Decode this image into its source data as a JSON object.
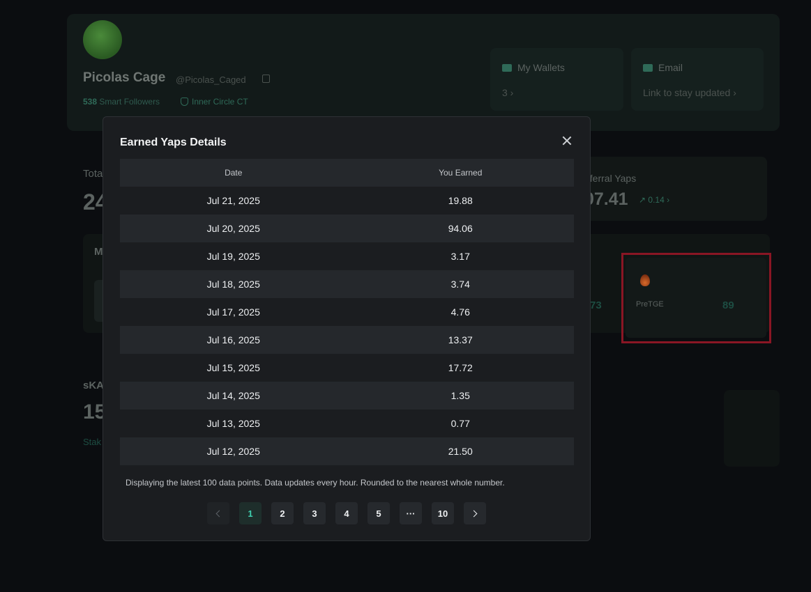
{
  "profile": {
    "name": "Picolas Cage",
    "handle": "@Picolas_Caged",
    "smart_followers_count": "538",
    "smart_followers_label": "Smart Followers",
    "inner_circle_label": "Inner Circle CT"
  },
  "cards": {
    "wallets_title": "My Wallets",
    "wallets_count": "3 ›",
    "email_title": "Email",
    "email_sub": "Link to stay updated ›"
  },
  "stats": {
    "total_label": "Tota",
    "total_value": "24",
    "referral_label": "eferral Yaps",
    "referral_value": "07.41",
    "referral_delta": "↗ 0.14 ›",
    "mid_label": "M",
    "mid_value": "73",
    "pretge_label": "PreTGE",
    "pretge_value": "89",
    "skaito_label": "sKA",
    "skaito_value": "15",
    "stake_link": "Stak"
  },
  "modal": {
    "title": "Earned Yaps Details",
    "columns": [
      "Date",
      "You Earned"
    ],
    "rows": [
      {
        "date": "Jul 21, 2025",
        "earned": "19.88"
      },
      {
        "date": "Jul 20, 2025",
        "earned": "94.06"
      },
      {
        "date": "Jul 19, 2025",
        "earned": "3.17"
      },
      {
        "date": "Jul 18, 2025",
        "earned": "3.74"
      },
      {
        "date": "Jul 17, 2025",
        "earned": "4.76"
      },
      {
        "date": "Jul 16, 2025",
        "earned": "13.37"
      },
      {
        "date": "Jul 15, 2025",
        "earned": "17.72"
      },
      {
        "date": "Jul 14, 2025",
        "earned": "1.35"
      },
      {
        "date": "Jul 13, 2025",
        "earned": "0.77"
      },
      {
        "date": "Jul 12, 2025",
        "earned": "21.50"
      }
    ],
    "footnote": "Displaying the latest 100 data points. Data updates every hour. Rounded to the nearest whole number.",
    "pagination": {
      "pages": [
        "1",
        "2",
        "3",
        "4",
        "5",
        "···",
        "10"
      ],
      "current": "1"
    }
  },
  "colors": {
    "accent": "#3fd0b0",
    "highlight_border": "#8a1624",
    "modal_bg": "#1b1d20"
  }
}
